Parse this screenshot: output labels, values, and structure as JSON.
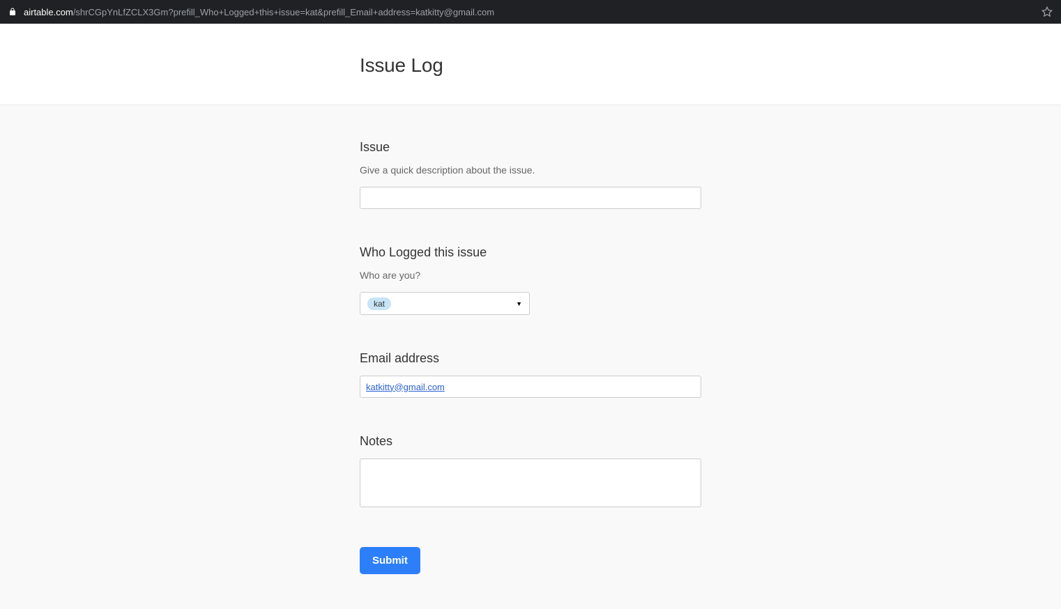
{
  "browser": {
    "url_domain": "airtable.com",
    "url_path": "/shrCGpYnLfZCLX3Gm?prefill_Who+Logged+this+issue=kat&prefill_Email+address=katkitty@gmail.com"
  },
  "header": {
    "title": "Issue Log"
  },
  "form": {
    "issue": {
      "label": "Issue",
      "help": "Give a quick description about the issue.",
      "value": ""
    },
    "who": {
      "label": "Who Logged this issue",
      "help": "Who are you?",
      "selected": "kat"
    },
    "email": {
      "label": "Email address",
      "value": "katkitty@gmail.com"
    },
    "notes": {
      "label": "Notes",
      "value": ""
    },
    "submit_label": "Submit"
  }
}
